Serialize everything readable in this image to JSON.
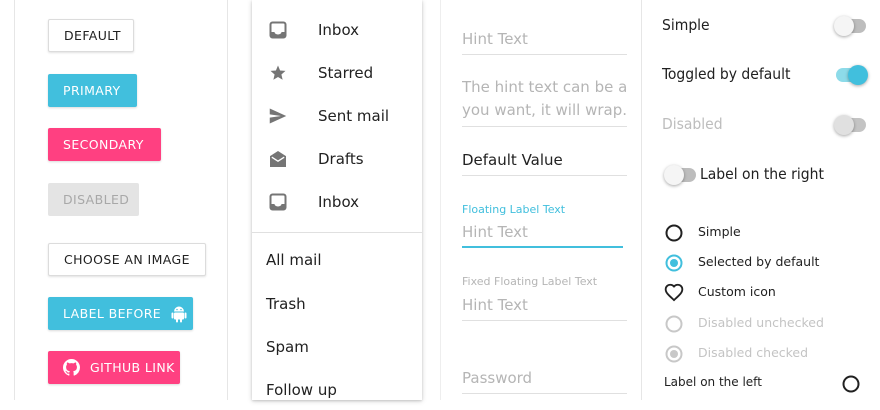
{
  "colors": {
    "primary": "#41bfdd",
    "secondary": "#ff4081",
    "disabled_bg": "#e4e4e4",
    "disabled_text": "#a8a8a8",
    "hint": "#b5b5b5"
  },
  "buttons": {
    "default": "DEFAULT",
    "primary": "PRIMARY",
    "secondary": "SECONDARY",
    "disabled": "DISABLED",
    "choose_image": "CHOOSE AN IMAGE",
    "label_before": "LABEL BEFORE",
    "label_before_icon": "android-icon",
    "github_link": "GITHUB LINK",
    "github_icon": "github-icon"
  },
  "menu": {
    "items": [
      {
        "label": "Inbox",
        "icon": "inbox-icon"
      },
      {
        "label": "Starred",
        "icon": "star-icon"
      },
      {
        "label": "Sent mail",
        "icon": "send-icon"
      },
      {
        "label": "Drafts",
        "icon": "drafts-icon"
      },
      {
        "label": "Inbox",
        "icon": "inbox-icon"
      }
    ],
    "secondary": [
      "All mail",
      "Trash",
      "Spam",
      "Follow up"
    ]
  },
  "fields": {
    "hint1": "Hint Text",
    "multiline_hint_1": "The hint text can be as long as",
    "multiline_hint_2": "you want, it will wrap.",
    "default_value": "Default Value",
    "floating_label": "Floating Label Text",
    "floating_hint": "Hint Text",
    "fixed_label": "Fixed Floating Label Text",
    "fixed_hint": "Hint Text",
    "password": "Password"
  },
  "toggles": [
    {
      "label": "Simple",
      "on": false,
      "disabled": false
    },
    {
      "label": "Toggled by default",
      "on": true,
      "disabled": false
    },
    {
      "label": "Disabled",
      "on": false,
      "disabled": true
    },
    {
      "label": "Label on the right",
      "on": false,
      "disabled": false
    }
  ],
  "radios": [
    {
      "label": "Simple",
      "state": "unchecked"
    },
    {
      "label": "Selected by default",
      "state": "checked"
    },
    {
      "label": "Custom icon",
      "state": "heart"
    },
    {
      "label": "Disabled unchecked",
      "state": "disabled-unchecked"
    },
    {
      "label": "Disabled checked",
      "state": "disabled-checked"
    }
  ],
  "label_on_left": "Label on the left"
}
